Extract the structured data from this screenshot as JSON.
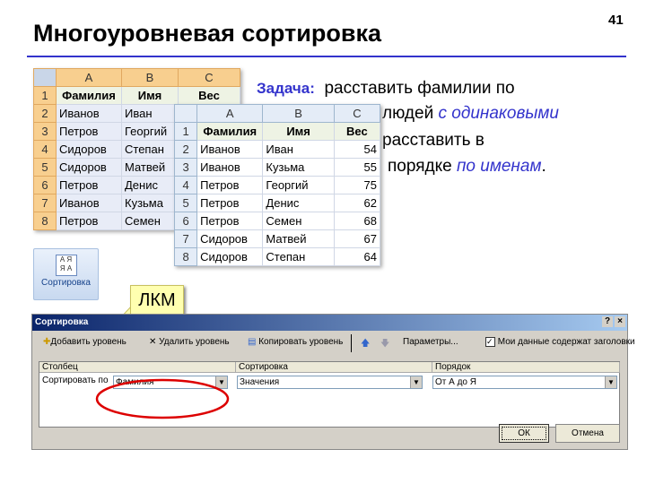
{
  "slide": {
    "title": "Многоуровневая сортировка",
    "page_number": "41"
  },
  "task": {
    "label": "Задача:",
    "line1": "расставить фамилии по",
    "line2a": "людей",
    "line2b": "с одинаковыми",
    "line3": "расставить в",
    "line4a": "порядке",
    "line4b": "по именам",
    "line4c": "."
  },
  "table1": {
    "cols": [
      "A",
      "B",
      "C"
    ],
    "header": [
      "Фамилия",
      "Имя",
      "Вес"
    ],
    "rows": [
      [
        "Иванов",
        "Иван"
      ],
      [
        "Петров",
        "Георгий"
      ],
      [
        "Сидоров",
        "Степан"
      ],
      [
        "Сидоров",
        "Матвей"
      ],
      [
        "Петров",
        "Денис"
      ],
      [
        "Иванов",
        "Кузьма"
      ],
      [
        "Петров",
        "Семен"
      ]
    ]
  },
  "table2": {
    "cols": [
      "A",
      "B",
      "C"
    ],
    "header": [
      "Фамилия",
      "Имя",
      "Вес"
    ],
    "rows": [
      [
        "Иванов",
        "Иван",
        "54"
      ],
      [
        "Иванов",
        "Кузьма",
        "55"
      ],
      [
        "Петров",
        "Георгий",
        "75"
      ],
      [
        "Петров",
        "Денис",
        "62"
      ],
      [
        "Петров",
        "Семен",
        "68"
      ],
      [
        "Сидоров",
        "Матвей",
        "67"
      ],
      [
        "Сидоров",
        "Степан",
        "64"
      ]
    ]
  },
  "sort_button": {
    "label": "Сортировка",
    "icon": "sort-az-icon"
  },
  "callout": {
    "text": "ЛКМ"
  },
  "dialog": {
    "title": "Сортировка",
    "help": "?",
    "close": "×",
    "add_level": "Добавить уровень",
    "delete_level": "Удалить уровень",
    "copy_level": "Копировать уровень",
    "params": "Параметры...",
    "headers_checkbox": "Мои данные содержат заголовки",
    "headers_checked": true,
    "col_headers": [
      "Столбец",
      "Сортировка",
      "Порядок"
    ],
    "sort_by": "Сортировать по",
    "column_value": "Фамилия",
    "sort_on": "Значения",
    "order": "От А до Я",
    "ok": "ОК",
    "cancel": "Отмена"
  },
  "colors": {
    "accent": "#3333cc",
    "highlight": "#dd0000"
  }
}
